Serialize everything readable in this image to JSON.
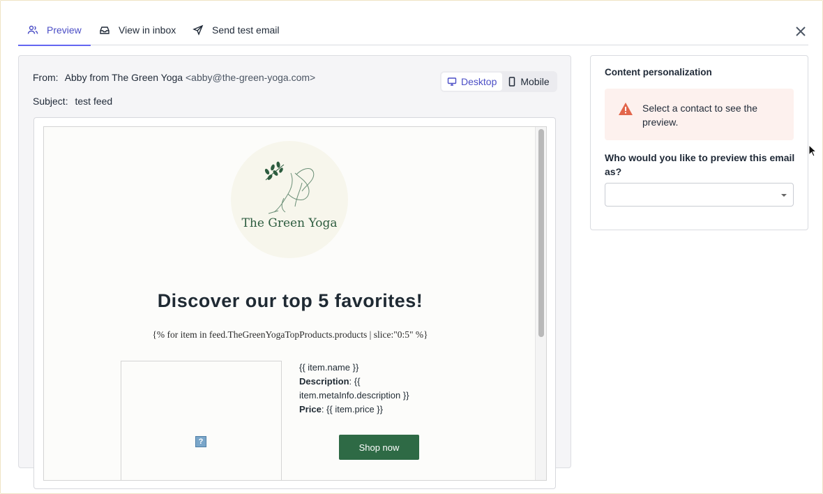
{
  "tabs": [
    {
      "label": "Preview",
      "icon": "users-icon",
      "active": true
    },
    {
      "label": "View in inbox",
      "icon": "inbox-icon",
      "active": false
    },
    {
      "label": "Send test email",
      "icon": "send-icon",
      "active": false
    }
  ],
  "preview": {
    "from_label": "From:",
    "from_name": "Abby from The Green Yoga",
    "from_email": "<abby@the-green-yoga.com>",
    "subject_label": "Subject:",
    "subject": "test feed",
    "device_toggle": {
      "desktop": "Desktop",
      "mobile": "Mobile",
      "selected": "Desktop"
    }
  },
  "email": {
    "logo_text": "The Green Yoga",
    "headline": "Discover our top 5 favorites!",
    "template_line": "{% for item in feed.TheGreenYogaTopProducts.products | slice:\"0:5\" %}",
    "broken_image_glyph": "?",
    "product": {
      "name": "{{ item.name }}",
      "description_label": "Description",
      "description_value": ": {{ item.metaInfo.description }}",
      "price_label": "Price",
      "price_value": ": {{ item.price }}",
      "button": "Shop now"
    }
  },
  "personalization": {
    "title": "Content personalization",
    "alert": "Select a contact to see the preview.",
    "question": "Who would you like to preview this email as?",
    "select_value": ""
  },
  "colors": {
    "accent": "#4b4ec6",
    "brand_green": "#2e6a45",
    "warning": "#e2654a"
  }
}
